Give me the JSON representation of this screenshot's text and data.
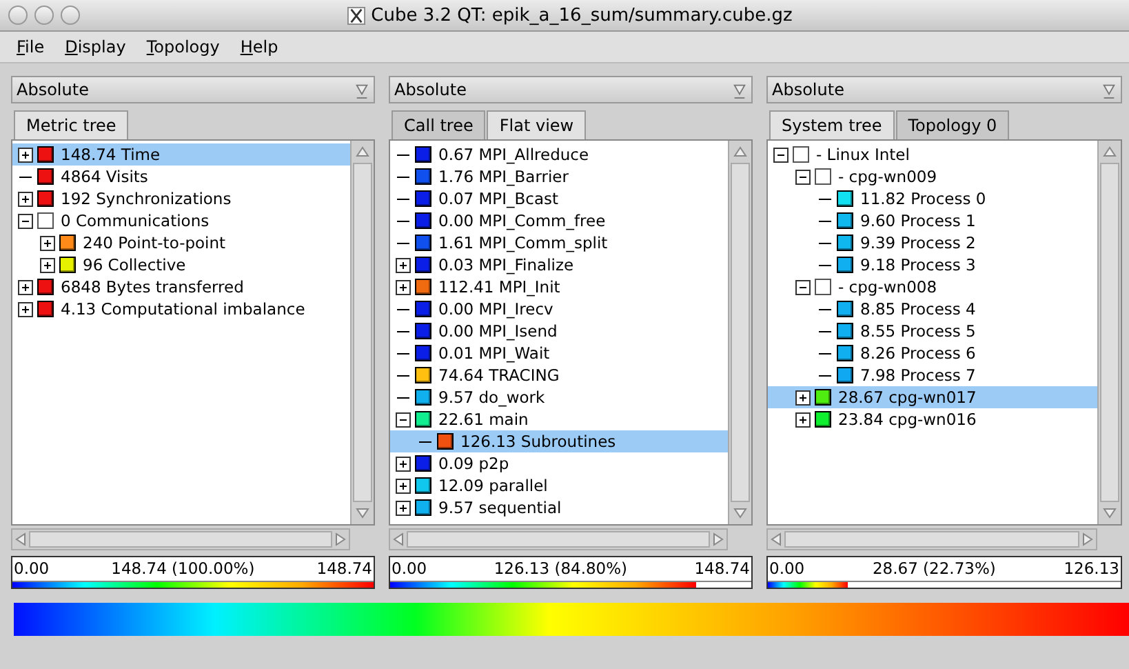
{
  "window": {
    "title": "Cube 3.2 QT: epik_a_16_sum/summary.cube.gz"
  },
  "menu": [
    {
      "label": "File"
    },
    {
      "label": "Display"
    },
    {
      "label": "Topology"
    },
    {
      "label": "Help"
    }
  ],
  "panels": [
    {
      "mode": "Absolute",
      "tabs": [
        {
          "label": "Metric tree",
          "selected": true
        }
      ],
      "tree": [
        {
          "label": "148.74 Time",
          "color": "#ee1111",
          "expanded": false,
          "selected": true
        },
        {
          "label": "4864 Visits",
          "color": "#ee1111",
          "selected": false
        },
        {
          "label": "192 Synchronizations",
          "color": "#ee1111",
          "expanded": false,
          "selected": false
        },
        {
          "label": "0 Communications",
          "expanded": true,
          "selected": false,
          "children": [
            {
              "label": "240 Point-to-point",
              "color": "#ff8a1a",
              "expanded": false,
              "selected": false
            },
            {
              "label": "96 Collective",
              "color": "#e6f000",
              "expanded": false,
              "selected": false
            }
          ]
        },
        {
          "label": "6848 Bytes transferred",
          "color": "#ee1111",
          "expanded": false,
          "selected": false
        },
        {
          "label": "4.13 Computational imbalance",
          "color": "#ee1111",
          "expanded": false,
          "selected": false
        }
      ],
      "scale": {
        "min": "0.00",
        "value": "148.74 (100.00%)",
        "max": "148.74",
        "level": 1.0
      }
    },
    {
      "mode": "Absolute",
      "tabs": [
        {
          "label": "Call tree",
          "selected": false
        },
        {
          "label": "Flat view",
          "selected": true
        }
      ],
      "tree": [
        {
          "label": "0.67 MPI_Allreduce",
          "color": "#0a1ee8",
          "selected": false
        },
        {
          "label": "1.76 MPI_Barrier",
          "color": "#1050ee",
          "selected": false
        },
        {
          "label": "0.07 MPI_Bcast",
          "color": "#0a1ee8",
          "selected": false
        },
        {
          "label": "0.00 MPI_Comm_free",
          "color": "#0a1ee8",
          "selected": false
        },
        {
          "label": "1.61 MPI_Comm_split",
          "color": "#1050ee",
          "selected": false
        },
        {
          "label": "0.03 MPI_Finalize",
          "color": "#0a1ee8",
          "expanded": false,
          "selected": false
        },
        {
          "label": "112.41 MPI_Init",
          "color": "#f06a10",
          "expanded": false,
          "selected": false
        },
        {
          "label": "0.00 MPI_Irecv",
          "color": "#0a1ee8",
          "selected": false
        },
        {
          "label": "0.00 MPI_Isend",
          "color": "#0a1ee8",
          "selected": false
        },
        {
          "label": "0.01 MPI_Wait",
          "color": "#0a1ee8",
          "selected": false
        },
        {
          "label": "74.64 TRACING",
          "color": "#ffc010",
          "selected": false
        },
        {
          "label": "9.57 do_work",
          "color": "#10b0ee",
          "selected": false
        },
        {
          "label": "22.61 main",
          "color": "#10ee90",
          "expanded": true,
          "selected": false,
          "children": [
            {
              "label": "126.13 Subroutines",
              "color": "#f05010",
              "selected": true
            }
          ]
        },
        {
          "label": "0.09 p2p",
          "color": "#0a1ee8",
          "expanded": false,
          "selected": false
        },
        {
          "label": "12.09 parallel",
          "color": "#10c8ee",
          "expanded": false,
          "selected": false
        },
        {
          "label": "9.57 sequential",
          "color": "#10b0ee",
          "expanded": false,
          "selected": false
        }
      ],
      "scale": {
        "min": "0.00",
        "value": "126.13 (84.80%)",
        "max": "148.74",
        "level": 0.848
      }
    },
    {
      "mode": "Absolute",
      "tabs": [
        {
          "label": "System tree",
          "selected": true
        },
        {
          "label": "Topology 0",
          "selected": false
        }
      ],
      "tree": [
        {
          "label": "- Linux Intel",
          "expanded": true,
          "selected": false,
          "children": [
            {
              "label": "- cpg-wn009",
              "expanded": true,
              "selected": false,
              "children": [
                {
                  "label": "11.82 Process 0",
                  "color": "#10e0f0",
                  "selected": false
                },
                {
                  "label": "9.60 Process 1",
                  "color": "#10b8f0",
                  "selected": false
                },
                {
                  "label": "9.39 Process 2",
                  "color": "#10b8f0",
                  "selected": false
                },
                {
                  "label": "9.18 Process 3",
                  "color": "#10b0f0",
                  "selected": false
                }
              ]
            },
            {
              "label": "- cpg-wn008",
              "expanded": true,
              "selected": false,
              "children": [
                {
                  "label": "8.85 Process 4",
                  "color": "#10b0f0",
                  "selected": false
                },
                {
                  "label": "8.55 Process 5",
                  "color": "#10b0f0",
                  "selected": false
                },
                {
                  "label": "8.26 Process 6",
                  "color": "#10b0f0",
                  "selected": false
                },
                {
                  "label": "7.98 Process 7",
                  "color": "#10a8f0",
                  "selected": false
                }
              ]
            },
            {
              "label": "28.67 cpg-wn017",
              "color": "#50ee10",
              "expanded": false,
              "selected": true
            },
            {
              "label": "23.84 cpg-wn016",
              "color": "#10ee30",
              "expanded": false,
              "selected": false
            }
          ]
        }
      ],
      "scale": {
        "min": "0.00",
        "value": "28.67 (22.73%)",
        "max": "126.13",
        "level": 0.2273
      }
    }
  ]
}
